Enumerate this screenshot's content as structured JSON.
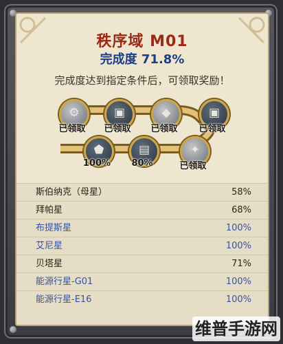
{
  "header": {
    "title": "秩序域 M01",
    "completion_label": "完成度 71.8%",
    "completion_value": 71.8,
    "instruction": "完成度达到指定条件后，可领取奖励！"
  },
  "rewards": [
    {
      "label": "已领取",
      "icon": "gear-ore-icon"
    },
    {
      "label": "已领取",
      "icon": "chest-badge-icon"
    },
    {
      "label": "已领取",
      "icon": "ore-pile-icon"
    },
    {
      "label": "已领取",
      "icon": "chest-badge-icon"
    },
    {
      "label": "已领取",
      "icon": "ore-cluster-icon"
    },
    {
      "label": "80%",
      "icon": "treasure-chest-icon"
    },
    {
      "label": "100%",
      "icon": "crystal-flask-icon"
    }
  ],
  "planets": [
    {
      "name": "斯伯纳克（母星）",
      "value": "58%",
      "status": "todo"
    },
    {
      "name": "拜帕星",
      "value": "68%",
      "status": "todo"
    },
    {
      "name": "布提斯星",
      "value": "100%",
      "status": "done"
    },
    {
      "name": "艾尼星",
      "value": "100%",
      "status": "done"
    },
    {
      "name": "贝塔星",
      "value": "71%",
      "status": "todo"
    },
    {
      "name": "能源行星-G01",
      "value": "100%",
      "status": "done"
    },
    {
      "name": "能源行星-E16",
      "value": "100%",
      "status": "done"
    }
  ],
  "watermark": "维普手游网",
  "colors": {
    "title": "#9a2a16",
    "completion": "#1c3f88",
    "done_row": "#3453a8",
    "track_gold": "#caa64e",
    "parchment": "#efe6cf"
  }
}
